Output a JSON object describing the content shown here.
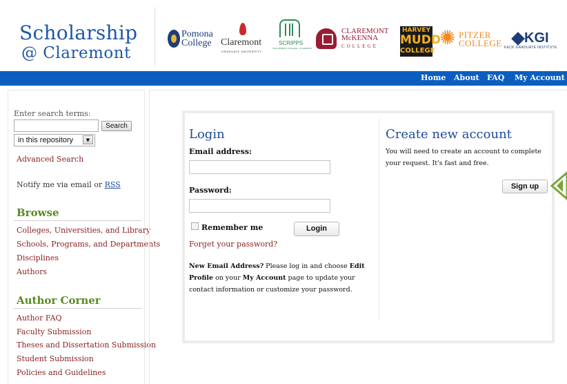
{
  "header": {
    "title_line1": "Scholarship",
    "title_line2": "@ Claremont",
    "logos": {
      "pomona": [
        "Pomona",
        "College"
      ],
      "cgu": [
        "Claremont",
        "GRADUATE UNIVERSITY"
      ],
      "scripps": [
        "SCRIPPS",
        "THE WOMEN'S COLLEGE · CLAREMONT"
      ],
      "cmc": [
        "CLAREMONT",
        "McKENNA",
        "COLLEGE"
      ],
      "hmc": [
        "HARVEY",
        "MUDD",
        "COLLEGE"
      ],
      "pitzer": [
        "PITZER",
        "COLLEGE"
      ],
      "kgi": [
        "KGI",
        "KECK GRADUATE INSTITUTE"
      ]
    }
  },
  "nav": {
    "home": "Home",
    "about": "About",
    "faq": "FAQ",
    "my_account": "My Account"
  },
  "sidebar": {
    "search_label": "Enter search terms:",
    "search_value": "",
    "search_button": "Search",
    "scope_value": "in this repository",
    "advanced_search": "Advanced Search",
    "notify_prefix": "Notify me via email or ",
    "notify_rss": "RSS",
    "browse_heading": "Browse",
    "browse_items": [
      "Colleges, Universities, and Library",
      "Schools, Programs, and Departments",
      "Disciplines",
      "Authors"
    ],
    "author_corner_heading": "Author Corner",
    "author_items": [
      "Author FAQ",
      "Faculty Submission",
      "Theses and Dissertation Submission",
      "Student Submission",
      "Policies and Guidelines"
    ]
  },
  "login": {
    "heading": "Login",
    "email_label": "Email address:",
    "email_value": "",
    "password_label": "Password:",
    "password_value": "",
    "remember_label": "Remember me",
    "remember_checked": false,
    "login_button": "Login",
    "forgot_link": "Forget your password?",
    "note_b1": "New Email Address?",
    "note_t1": " Please log in and choose ",
    "note_b2": "Edit Profile",
    "note_t2": " on your ",
    "note_b3": "My Account",
    "note_t3": " page to update your contact information or customize your password."
  },
  "create": {
    "heading": "Create new account",
    "description": "You will need to create an account to complete your request. It's fast and free.",
    "signup_button": "Sign up"
  },
  "colors": {
    "brand_blue": "#1d58a7",
    "nav_blue": "#0b5ebf",
    "link_red": "#8b2121",
    "heading_green": "#5a8a22",
    "callout_green": "#7aa33a"
  }
}
